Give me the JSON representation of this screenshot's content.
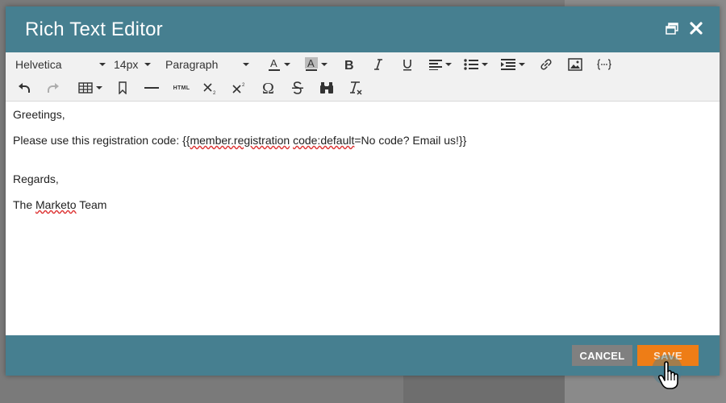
{
  "dialog": {
    "title": "Rich Text Editor",
    "header_icons": [
      "restore-window-icon",
      "close-icon"
    ]
  },
  "toolbar": {
    "font_family": "Helvetica",
    "font_size": "14px",
    "block_format": "Paragraph",
    "row1_tools": [
      "text-color-icon",
      "background-color-icon",
      "bold-icon",
      "italic-icon",
      "underline-icon",
      "align-icon",
      "bullet-list-icon",
      "indent-icon",
      "link-icon",
      "image-icon",
      "code-snippet-icon"
    ],
    "row2_tools": [
      "undo-icon",
      "redo-icon",
      "table-icon",
      "bookmark-icon",
      "horizontal-rule-icon",
      "html-source-icon",
      "subscript-icon",
      "superscript-icon",
      "special-character-icon",
      "strikethrough-icon",
      "find-replace-icon",
      "clear-formatting-icon"
    ],
    "html_label": "HTML"
  },
  "content": {
    "greeting": "Greetings,",
    "code_line_prefix": "Please use this registration code: {{",
    "code_word1": "member.registration",
    "code_space": " ",
    "code_word2": "code:default",
    "code_line_suffix": "=No code? Email us!}}",
    "regards": "Regards,",
    "signoff_prefix": "The ",
    "signoff_brand": "Marketo",
    "signoff_suffix": " Team"
  },
  "footer": {
    "cancel_label": "CANCEL",
    "save_label": "SAVE"
  },
  "colors": {
    "header": "#467f90",
    "save": "#ee7d16",
    "cancel": "#808080",
    "toolbar_bg": "#f1f1f1"
  }
}
